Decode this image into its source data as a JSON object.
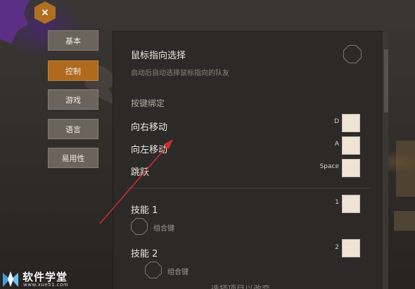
{
  "tabs": [
    {
      "label": "基本"
    },
    {
      "label": "控制"
    },
    {
      "label": "游戏"
    },
    {
      "label": "语言"
    },
    {
      "label": "易用性"
    }
  ],
  "close_label": "×",
  "settings": {
    "mouse_select_title": "鼠标指向选择",
    "mouse_select_desc": "启动后自动选择鼠标指向的队友",
    "keybind_section": "按键绑定",
    "bindings": [
      {
        "action": "向右移动",
        "key": "D"
      },
      {
        "action": "向左移动",
        "key": "A"
      },
      {
        "action": "跳跃",
        "key": "Space"
      }
    ],
    "skills": [
      {
        "name": "技能 1",
        "key": "1",
        "combo_label": "组合键"
      },
      {
        "name": "技能 2",
        "key": "2",
        "combo_label": "组合键"
      }
    ],
    "footer_hint": "选择项目以改变"
  },
  "watermark": {
    "name": "软件学堂",
    "url": "www.xue51.com"
  },
  "colors": {
    "accent": "#b06a1e",
    "arrow": "#d42a2a",
    "panel_bg": "#2c2a28",
    "key_box": "#efe4d6"
  }
}
